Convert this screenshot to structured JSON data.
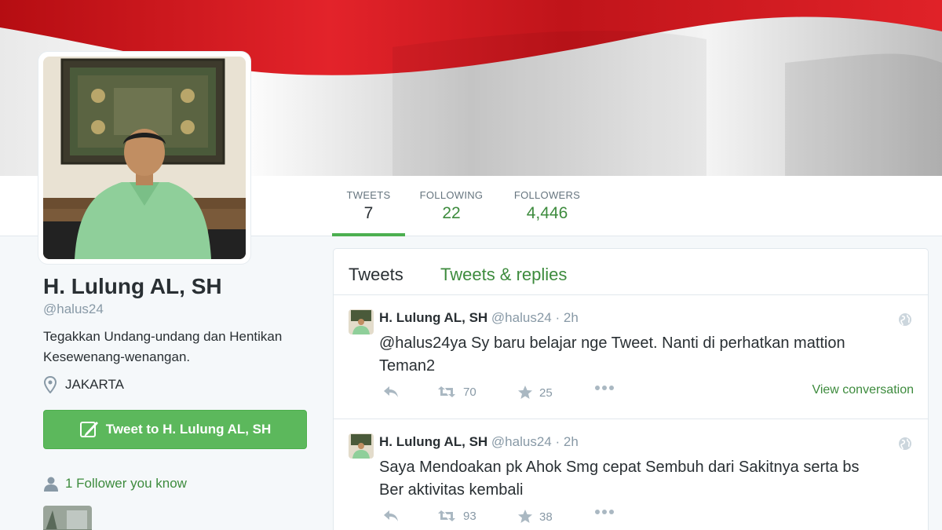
{
  "profile": {
    "name": "H. Lulung AL, SH",
    "handle": "@halus24",
    "bio": "Tegakkan Undang-undang dan Hentikan Kesewenang-wenangan.",
    "location": "JAKARTA",
    "tweet_to_label": "Tweet to H. Lulung AL, SH",
    "followers_you_know": "1 Follower you know"
  },
  "stats": [
    {
      "label": "TWEETS",
      "value": "7"
    },
    {
      "label": "FOLLOWING",
      "value": "22"
    },
    {
      "label": "FOLLOWERS",
      "value": "4,446"
    }
  ],
  "timeline": {
    "tabs": [
      "Tweets",
      "Tweets & replies"
    ],
    "tweets": [
      {
        "name": "H. Lulung AL, SH",
        "handle": "@halus24",
        "time": "2h",
        "text": "@halus24ya Sy baru belajar nge Tweet. Nanti di perhatkan mattion Teman2",
        "retweets": "70",
        "likes": "25",
        "view_conversation": "View conversation"
      },
      {
        "name": "H. Lulung AL, SH",
        "handle": "@halus24",
        "time": "2h",
        "text": "Saya Mendoakan pk Ahok Smg cepat Sembuh dari Sakitnya serta bs Ber aktivitas kembali",
        "retweets": "93",
        "likes": "38"
      }
    ]
  },
  "colors": {
    "accent_green": "#3d8b3d",
    "button_green": "#5cb85c",
    "flag_red": "#d4161c",
    "background": "#f5f8fa"
  }
}
